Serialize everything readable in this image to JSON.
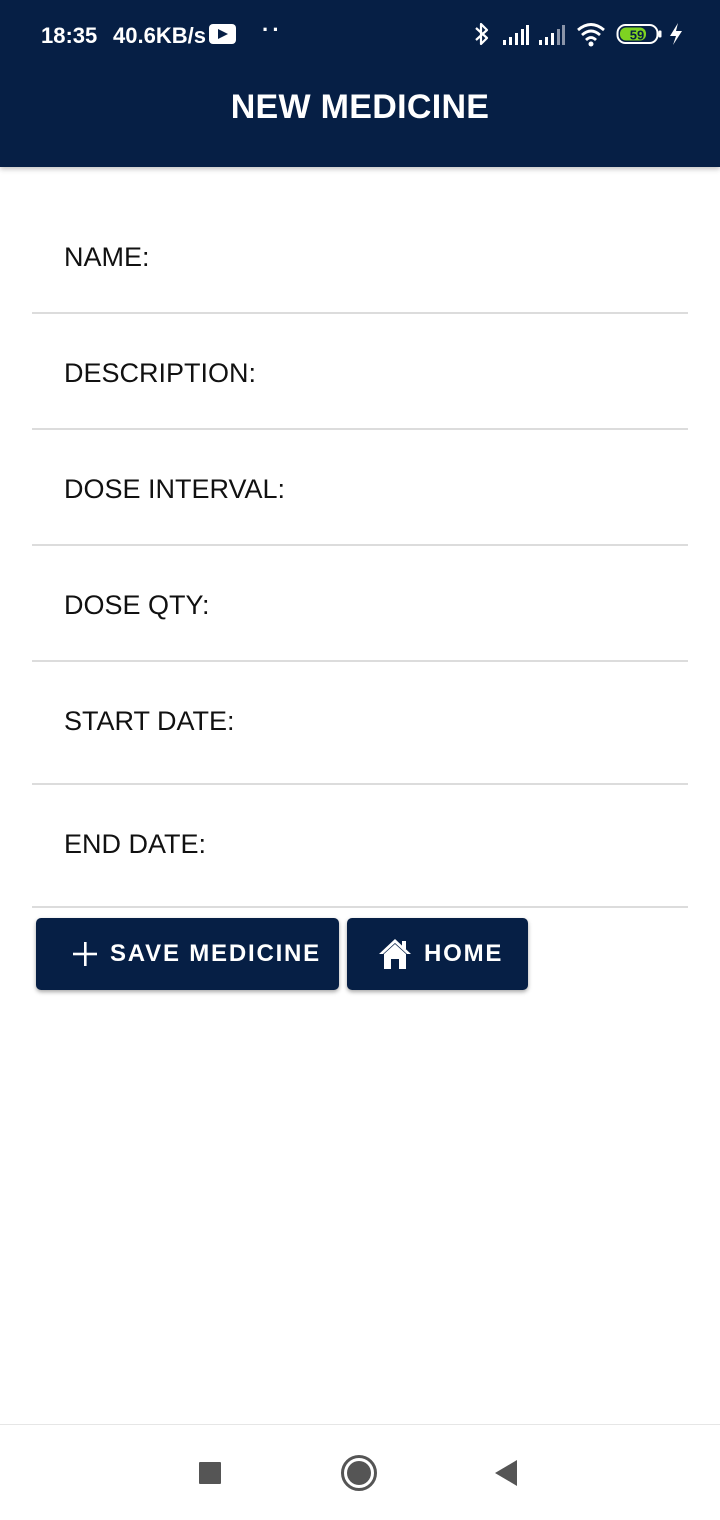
{
  "status_bar": {
    "time": "18:35",
    "network_speed": "40.6KB/s",
    "dots": "··",
    "battery": "59"
  },
  "header": {
    "title": "NEW MEDICINE"
  },
  "form": {
    "fields": [
      {
        "label": "NAME:",
        "value": ""
      },
      {
        "label": "DESCRIPTION:",
        "value": ""
      },
      {
        "label": "DOSE INTERVAL:",
        "value": ""
      },
      {
        "label": "DOSE QTY:",
        "value": ""
      },
      {
        "label": "START DATE:",
        "value": ""
      },
      {
        "label": "END DATE:",
        "value": ""
      }
    ]
  },
  "actions": {
    "save_label": "SAVE MEDICINE",
    "save_icon": "plus-icon",
    "home_label": "HOME",
    "home_icon": "home-icon"
  },
  "navigation": {
    "recents": "square-icon",
    "home": "circle-icon",
    "back": "triangle-back-icon"
  },
  "colors": {
    "primary": "#061f45",
    "divider": "#dcdcdc",
    "battery_accent": "#7ed321"
  }
}
